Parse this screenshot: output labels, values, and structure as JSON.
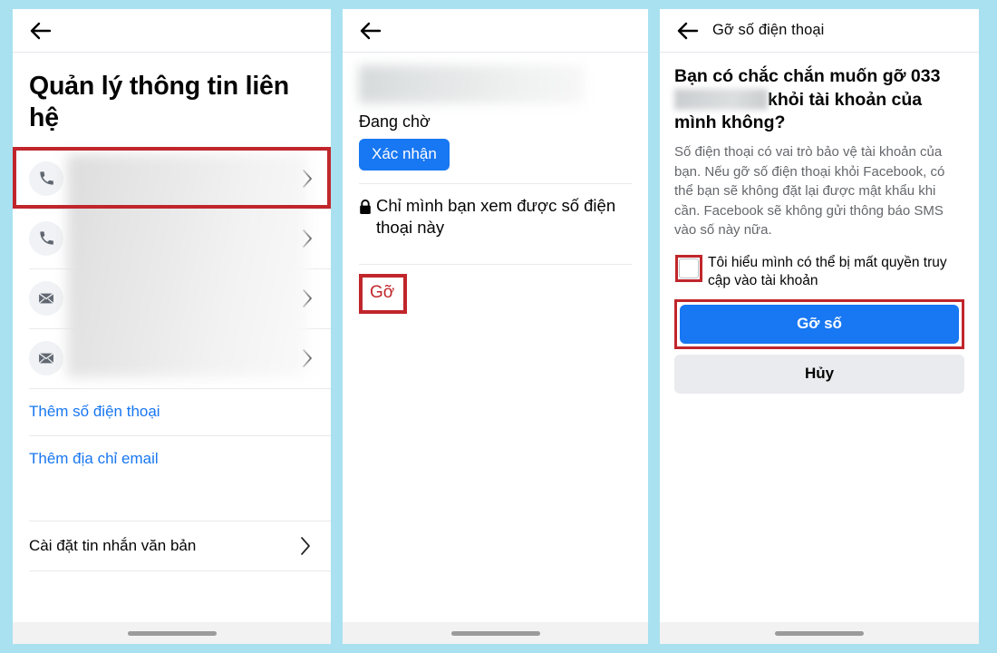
{
  "background_color": "#a9e1f0",
  "accent_blue": "#1877f2",
  "highlight_red": "#c0262b",
  "panel1": {
    "back_icon": "back-arrow-icon",
    "page_title": "Quản lý thông tin liên hệ",
    "rows": [
      {
        "icon": "phone-icon",
        "value": "",
        "chevron": "chevron-right-icon",
        "highlighted": true
      },
      {
        "icon": "phone-icon",
        "value": "",
        "chevron": "chevron-right-icon",
        "highlighted": false
      },
      {
        "icon": "envelope-icon",
        "value": "",
        "chevron": "chevron-right-icon",
        "highlighted": false
      },
      {
        "icon": "envelope-icon",
        "value": "",
        "chevron": "chevron-right-icon",
        "highlighted": false
      }
    ],
    "add_phone_label": "Thêm số điện thoại",
    "add_email_label": "Thêm địa chỉ email",
    "sms_settings_label": "Cài đặt tin nhắn văn bản"
  },
  "panel2": {
    "back_icon": "back-arrow-icon",
    "phone_value": "",
    "status_label": "Đang chờ",
    "confirm_button": "Xác nhận",
    "privacy_icon": "lock-icon",
    "privacy_note": "Chỉ mình bạn xem được số điện thoại này",
    "remove_link": "Gỡ"
  },
  "panel3": {
    "back_icon": "back-arrow-icon",
    "title": "Gỡ số điện thoại",
    "heading_part1": "Bạn có chắc chắn muốn gỡ 033",
    "heading_masked": "",
    "heading_part2": "khỏi tài khoản của mình không?",
    "body": "Số điện thoại có vai trò bảo vệ tài khoản của bạn. Nếu gỡ số điện thoại khỏi Facebook, có thể bạn sẽ không đặt lại được mật khẩu khi cần. Facebook sẽ không gửi thông báo SMS vào số này nữa.",
    "checkbox_checked": false,
    "checkbox_label": "Tôi hiểu mình có thể bị mất quyền truy cập vào tài khoản",
    "primary_button": "Gỡ số",
    "secondary_button": "Hủy"
  }
}
